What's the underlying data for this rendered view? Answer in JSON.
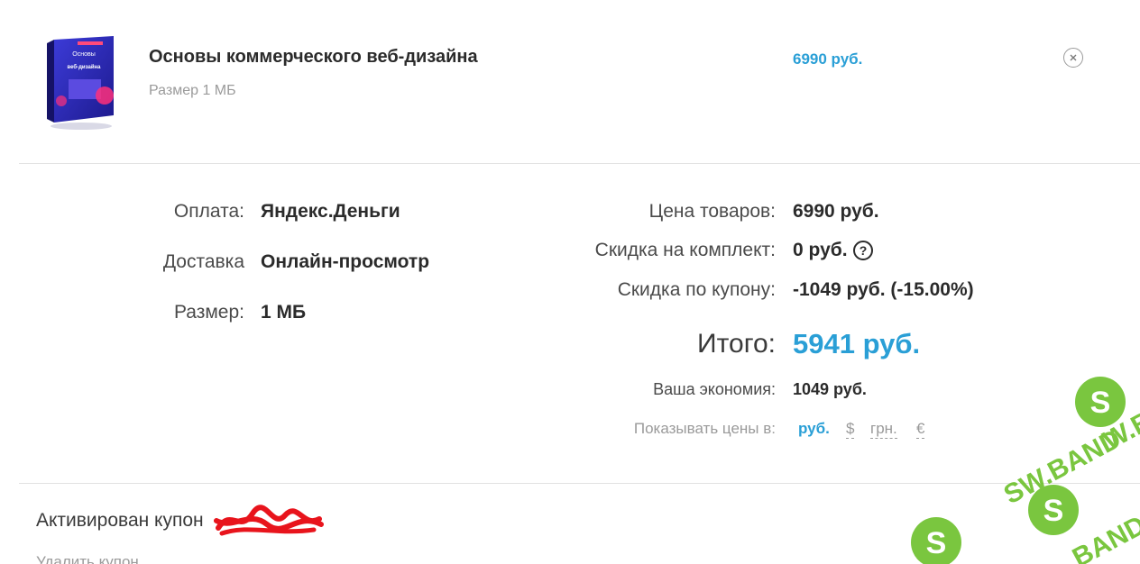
{
  "product": {
    "title": "Основы коммерческого веб-дизайна",
    "size": "Размер 1 МБ",
    "price": "6990 руб.",
    "cover_text": "Основы коммерческого веб-дизайна"
  },
  "details": {
    "payment_label": "Оплата:",
    "payment_value": "Яндекс.Деньги",
    "delivery_label": "Доставка",
    "delivery_value": "Онлайн-просмотр",
    "size_label": "Размер:",
    "size_value": "1 МБ"
  },
  "summary": {
    "goods_label": "Цена товаров:",
    "goods_value": "6990 руб.",
    "bundle_label": "Скидка на комплект:",
    "bundle_value": "0 руб.",
    "help_icon_glyph": "?",
    "coupon_label": "Скидка по купону:",
    "coupon_value": "-1049 руб. (-15.00%)",
    "total_label": "Итого:",
    "total_value": "5941 руб.",
    "savings_label": "Ваша экономия:",
    "savings_value": "1049 руб.",
    "currency_label": "Показывать цены в:",
    "currencies": [
      "руб.",
      "$",
      "грн.",
      "€"
    ],
    "active_currency": "руб."
  },
  "coupon": {
    "activated_label": "Активирован купон",
    "remove_label": "Удалить купон"
  },
  "watermark": {
    "text": "SW.BAND"
  },
  "colors": {
    "accent": "#2a9fd6",
    "watermark_green": "#6cc02b",
    "redaction_red": "#e8141c"
  },
  "icons": {
    "remove": "close-circle-icon",
    "help": "question-circle-icon"
  }
}
